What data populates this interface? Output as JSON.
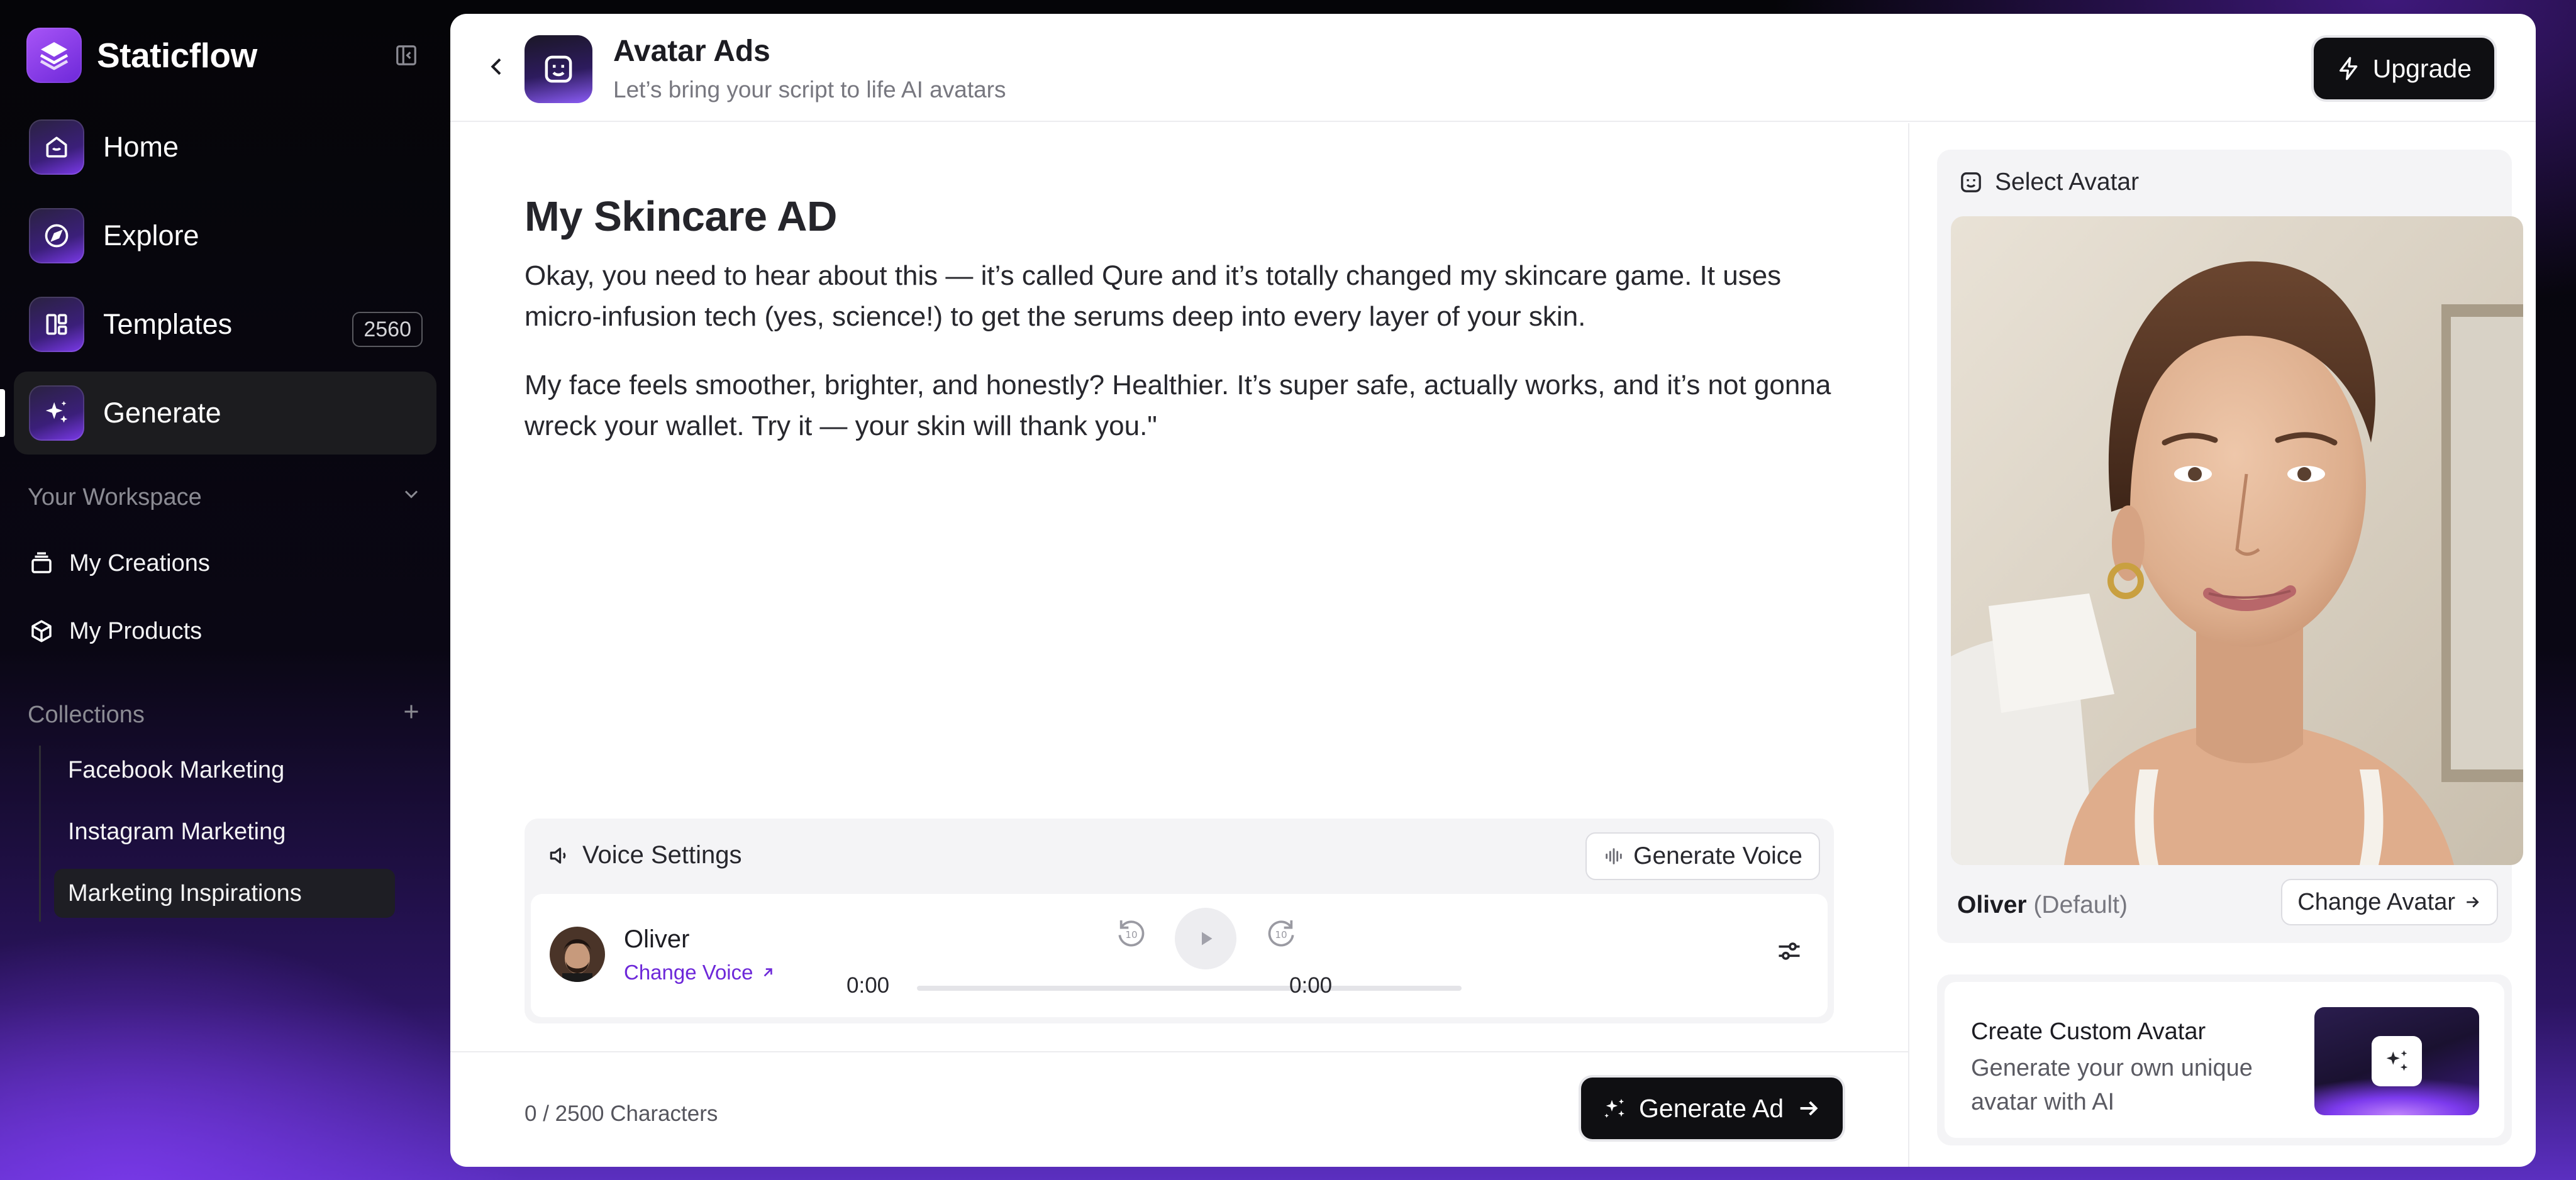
{
  "brand": {
    "name": "Staticflow"
  },
  "nav": {
    "items": [
      {
        "label": "Home"
      },
      {
        "label": "Explore"
      },
      {
        "label": "Templates",
        "badge": "2560"
      },
      {
        "label": "Generate"
      }
    ]
  },
  "workspace": {
    "heading": "Your Workspace",
    "items": [
      {
        "label": "My Creations"
      },
      {
        "label": "My Products"
      }
    ]
  },
  "collections": {
    "heading": "Collections",
    "items": [
      {
        "label": "Facebook Marketing"
      },
      {
        "label": "Instagram Marketing"
      },
      {
        "label": "Marketing Inspirations"
      }
    ]
  },
  "header": {
    "title": "Avatar Ads",
    "subtitle": "Let’s bring your script to life AI avatars",
    "upgrade_label": "Upgrade"
  },
  "script": {
    "title": "My Skincare AD",
    "paragraphs": [
      "Okay, you need to hear about this — it’s called Qure and it’s totally changed my skincare game. It uses micro-infusion tech (yes, science!) to get the serums deep into every layer of your skin.",
      "My face feels smoother, brighter, and honestly? Healthier. It’s super safe, actually works, and it’s not gonna wreck your wallet. Try it — your skin will thank you.\""
    ]
  },
  "voice": {
    "heading": "Voice Settings",
    "generate_label": "Generate Voice",
    "voice_name": "Oliver",
    "change_label": "Change Voice",
    "time_current": "0:00",
    "time_total": "0:00",
    "progress": 0
  },
  "footer": {
    "char_count": "0 / 2500 Characters",
    "generate_label": "Generate Ad"
  },
  "avatar": {
    "heading": "Select Avatar",
    "name": "Oliver",
    "default_tag": "(Default)",
    "change_label": "Change Avatar"
  },
  "custom_avatar": {
    "title": "Create Custom Avatar",
    "description": "Generate your own unique avatar with AI"
  },
  "colors": {
    "accent": "#6d28d9",
    "brand_gradient_start": "#a855f7",
    "dark_button": "#0f0f12"
  }
}
